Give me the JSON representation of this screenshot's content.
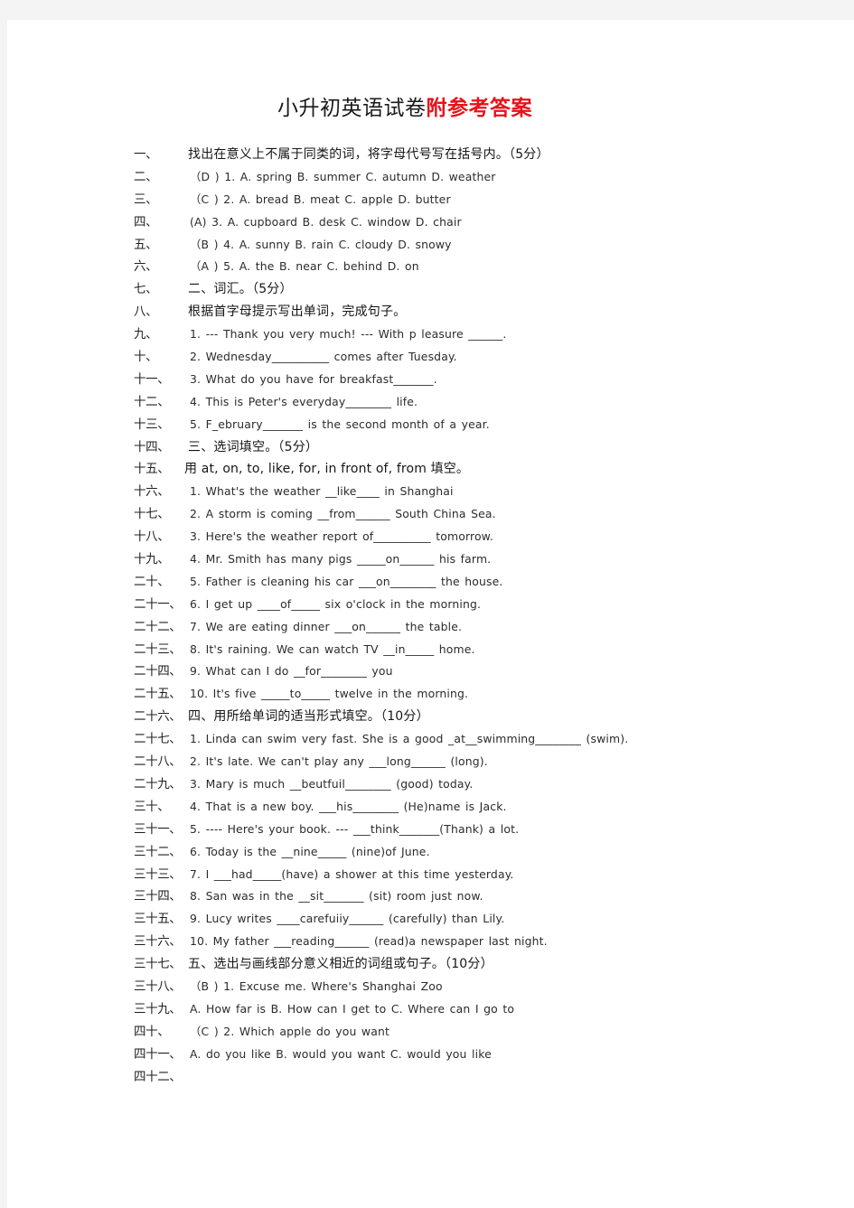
{
  "document": {
    "title_black": "小升初英语试卷",
    "title_red": "附参考答案",
    "title_full": "小升初英语试卷附参考答案",
    "accent_red": "#e8121a",
    "text_color": "#2b2b2b",
    "page_background": "#ffffff",
    "canvas_background": "#f4f4f4"
  },
  "lines": [
    {
      "num": "一、",
      "text": "找出在意义上不属于同类的词，将字母代号写在括号内。（5分）",
      "style": "cn"
    },
    {
      "num": "二、",
      "text": "（D ) 1. A. spring B. summer C. autumn D. weather",
      "style": "en"
    },
    {
      "num": "三、",
      "text": "（C ) 2. A. bread B. meat C. apple D. butter",
      "style": "en"
    },
    {
      "num": "四、",
      "text": "(A) 3. A. cupboard B. desk C. window D. chair",
      "style": "en"
    },
    {
      "num": "五、",
      "text": "（B ) 4. A. sunny B. rain C. cloudy D. snowy",
      "style": "en"
    },
    {
      "num": "六、",
      "text": "（A ) 5. A. the B. near C. behind D. on",
      "style": "en"
    },
    {
      "num": "七、",
      "text": "二、词汇。（5分）",
      "style": "cn"
    },
    {
      "num": "八、",
      "text": "根据首字母提示写出单词，完成句子。",
      "style": "cn"
    },
    {
      "num": "九、",
      "text": "1. --- Thank you very much! --- With p leasure ______.",
      "style": "en"
    },
    {
      "num": "十、",
      "text": "2. Wednesday__________ comes after Tuesday.",
      "style": "en"
    },
    {
      "num": "十一、",
      "text": "3. What do you have for breakfast_______.",
      "style": "en"
    },
    {
      "num": "十二、",
      "text": "4. This is Peter's everyday________ life.",
      "style": "en"
    },
    {
      "num": "十三、",
      "text": "5. F_ebruary_______ is the second month of a year.",
      "style": "en"
    },
    {
      "num": "十四、",
      "text": "三、选词填空。（5分）",
      "style": "cn"
    },
    {
      "num": "十五、",
      "text": "用 at, on, to, like, for, in front of, from 填空。",
      "style": "mixed"
    },
    {
      "num": "十六、",
      "text": "1. What's the weather __like____ in Shanghai",
      "style": "en"
    },
    {
      "num": "十七、",
      "text": "2. A storm is coming __from______ South China Sea.",
      "style": "en"
    },
    {
      "num": "十八、",
      "text": "3. Here's the weather report   of__________ tomorrow.",
      "style": "en"
    },
    {
      "num": "十九、",
      "text": "4. Mr. Smith has many pigs _____on______ his farm.",
      "style": "en"
    },
    {
      "num": "二十、",
      "text": "5. Father is cleaning his car ___on________ the house.",
      "style": "en"
    },
    {
      "num": "二十一、",
      "text": "6. I get up ____of_____ six o'clock in the morning.",
      "style": "en"
    },
    {
      "num": "二十二、",
      "text": "7. We are eating dinner ___on______ the table.",
      "style": "en"
    },
    {
      "num": "二十三、",
      "text": "8. It's raining. We can watch TV __in_____ home.",
      "style": "en"
    },
    {
      "num": "二十四、",
      "text": "9. What can I do __for________ you",
      "style": "en"
    },
    {
      "num": "二十五、",
      "text": "10. It's five _____to_____ twelve in the morning.",
      "style": "en"
    },
    {
      "num": "二十六、",
      "text": "四、用所给单词的适当形式填空。（10分）",
      "style": "cn"
    },
    {
      "num": "二十七、",
      "text": "1. Linda can swim very fast. She is a good _at__swimming________ (swim).",
      "style": "en"
    },
    {
      "num": "二十八、",
      "text": "2. It's late. We can't play any ___long______ (long).",
      "style": "en"
    },
    {
      "num": "二十九、",
      "text": "3. Mary is much __beutfuil________ (good) today.",
      "style": "en"
    },
    {
      "num": "三十、",
      "text": "4. That is a new boy. ___his________ (He)name is Jack.",
      "style": "en"
    },
    {
      "num": "三十一、",
      "text": "5. ---- Here's your book. --- ___think_______(Thank) a lot.",
      "style": "en"
    },
    {
      "num": "三十二、",
      "text": "6. Today is the __nine_____ (nine)of June.",
      "style": "en"
    },
    {
      "num": "三十三、",
      "text": "7. I ___had_____(have) a shower at this time yesterday.",
      "style": "en"
    },
    {
      "num": "三十四、",
      "text": "8. San was in the __sit_______ (sit) room just now.",
      "style": "en"
    },
    {
      "num": "三十五、",
      "text": "9. Lucy writes ____carefuiiy______ (carefully) than Lily.",
      "style": "en"
    },
    {
      "num": "三十六、",
      "text": "10. My father ___reading______ (read)a newspaper last night.",
      "style": "en"
    },
    {
      "num": "三十七、",
      "text": "五、选出与画线部分意义相近的词组或句子。（10分）",
      "style": "cn"
    },
    {
      "num": "三十八、",
      "text": "（B ) 1. Excuse me. Where's Shanghai Zoo",
      "style": "en"
    },
    {
      "num": "三十九、",
      "text": "A. How far is B. How can I get to C. Where can I go to",
      "style": "en"
    },
    {
      "num": "四十、",
      "text": "（C ) 2. Which apple do you want",
      "style": "en"
    },
    {
      "num": "四十一、",
      "text": "A. do you like B. would you want C. would you like",
      "style": "en"
    },
    {
      "num": "四十二、",
      "text": "",
      "style": "empty"
    }
  ]
}
